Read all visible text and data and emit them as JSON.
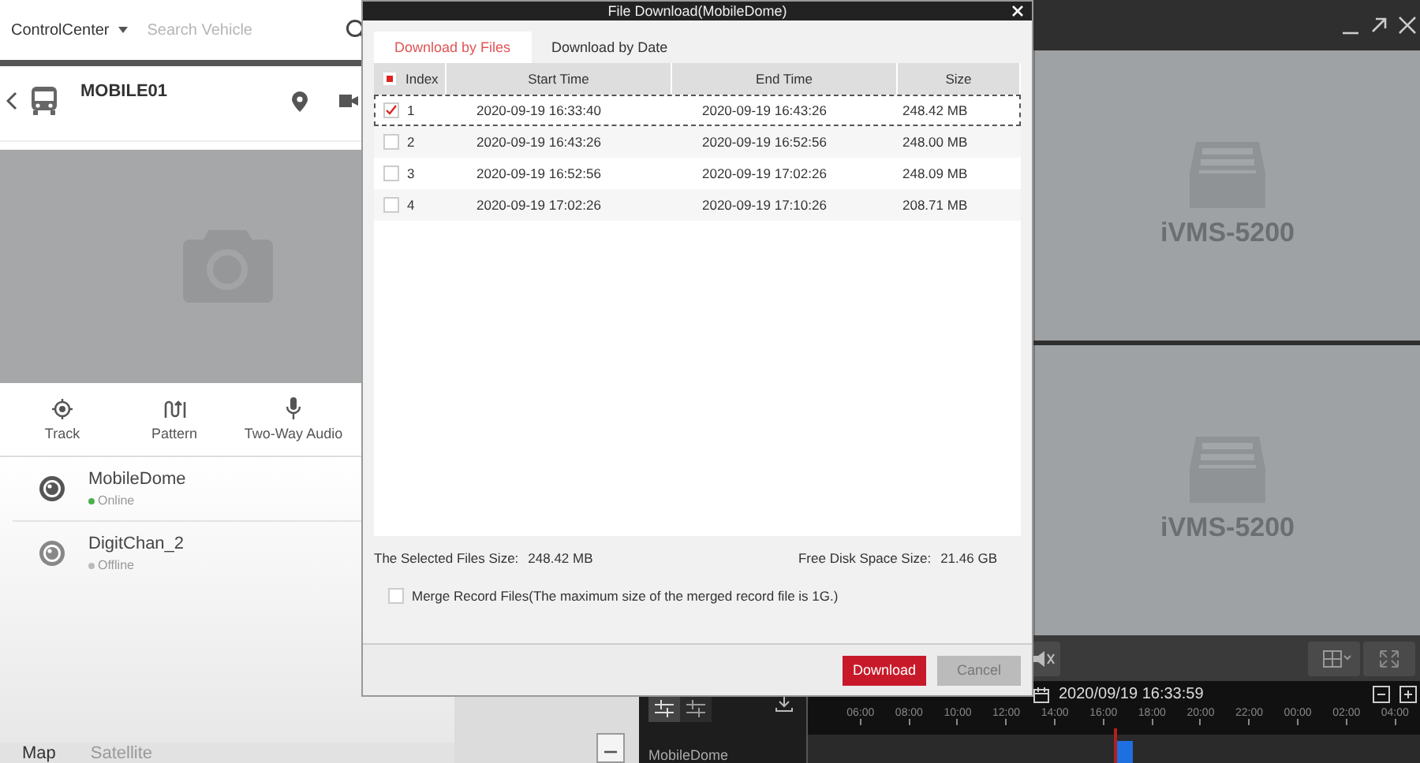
{
  "left_panel": {
    "selector": "ControlCenter",
    "search": {
      "placeholder": "Search Vehicle"
    },
    "vehicle": {
      "name": "MOBILE01"
    },
    "actions": [
      {
        "label": "Track",
        "kind": "track"
      },
      {
        "label": "Pattern",
        "kind": "pattern"
      },
      {
        "label": "Two-Way Audio",
        "kind": "audio"
      }
    ],
    "channels": [
      {
        "name": "MobileDome",
        "status": "Online",
        "online": true
      },
      {
        "name": "DigitChan_2",
        "status": "Offline",
        "online": false
      }
    ],
    "map_tabs": [
      {
        "label": "Map",
        "selected": true
      },
      {
        "label": "Satellite",
        "selected": false
      }
    ]
  },
  "playback": {
    "tiles": [
      {
        "label": "iVMS-5200"
      },
      {
        "label": "iVMS-5200"
      }
    ],
    "channel": "MobileDome",
    "date": "2020/09/19 16:33:59",
    "ticks": [
      "06:00",
      "08:00",
      "10:00",
      "12:00",
      "14:00",
      "16:00",
      "18:00",
      "20:00",
      "22:00",
      "00:00",
      "02:00",
      "04:00"
    ]
  },
  "dialog": {
    "title": "File Download(MobileDome)",
    "tabs": [
      {
        "label": "Download by Files",
        "selected": true
      },
      {
        "label": "Download by Date",
        "selected": false
      }
    ],
    "select_all_partial": true,
    "columns": [
      "Index",
      "Start Time",
      "End Time",
      "Size"
    ],
    "rows": [
      {
        "index": "1",
        "start": "2020-09-19 16:33:40",
        "end": "2020-09-19 16:43:26",
        "size": "248.42 MB",
        "checked": true,
        "focused": true
      },
      {
        "index": "2",
        "start": "2020-09-19 16:43:26",
        "end": "2020-09-19 16:52:56",
        "size": "248.00 MB",
        "checked": false,
        "focused": false
      },
      {
        "index": "3",
        "start": "2020-09-19 16:52:56",
        "end": "2020-09-19 17:02:26",
        "size": "248.09 MB",
        "checked": false,
        "focused": false
      },
      {
        "index": "4",
        "start": "2020-09-19 17:02:26",
        "end": "2020-09-19 17:10:26",
        "size": "208.71 MB",
        "checked": false,
        "focused": false
      }
    ],
    "selected_size_label": "The Selected Files Size:",
    "selected_size": "248.42 MB",
    "free_space_label": "Free Disk Space Size:",
    "free_space": "21.46 GB",
    "merge": {
      "label": "Merge Record Files(The maximum size of the merged record file is 1G.)",
      "checked": false
    },
    "buttons": [
      {
        "label": "Download",
        "kind": "primary"
      },
      {
        "label": "Cancel",
        "kind": "secondary"
      }
    ]
  }
}
